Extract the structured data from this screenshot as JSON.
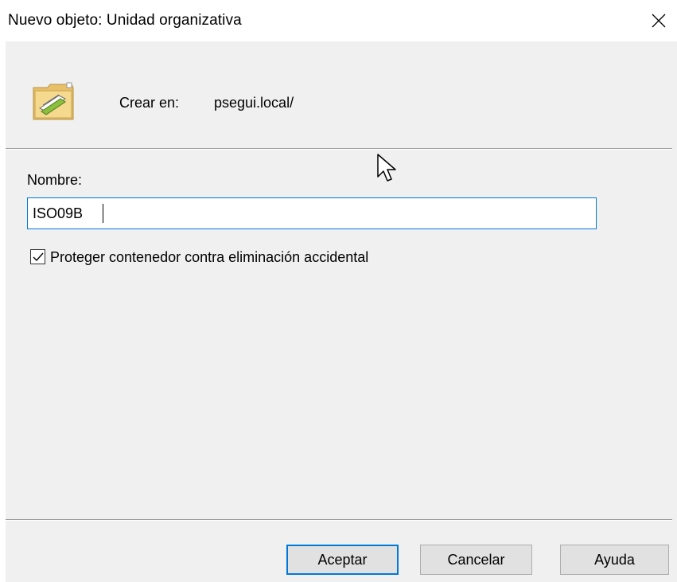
{
  "window": {
    "title": "Nuevo objeto: Unidad organizativa"
  },
  "header": {
    "create_in_label": "Crear en:",
    "create_in_value": "psegui.local/",
    "icon": "organizational-unit-folder-icon"
  },
  "form": {
    "name_label": "Nombre:",
    "name_value": "ISO09B",
    "protect_checkbox": {
      "label": "Proteger contenedor contra eliminación accidental",
      "checked": true
    }
  },
  "buttons": {
    "ok": "Aceptar",
    "cancel": "Cancelar",
    "help": "Ayuda"
  },
  "colors": {
    "accent": "#0078d7",
    "dialog_background": "#f0f0f0"
  }
}
